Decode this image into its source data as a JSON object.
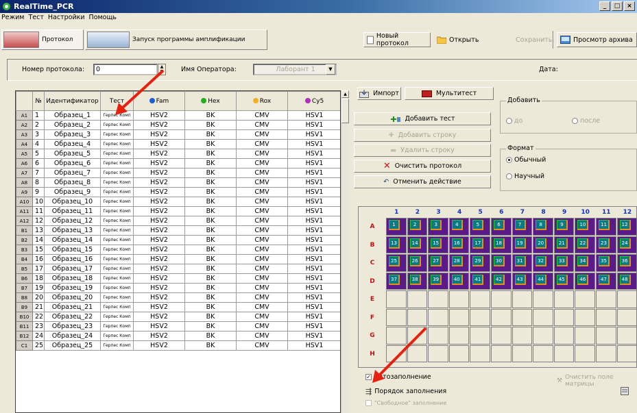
{
  "window": {
    "title": "RealTime_PCR"
  },
  "menu": [
    "Режим",
    "Тест",
    "Настройки",
    "Помощь"
  ],
  "tabs": [
    {
      "label": "Протокол"
    },
    {
      "label": "Запуск программы амплификации"
    }
  ],
  "toolbar": {
    "new_protocol": "Новый протокол",
    "open": "Открыть",
    "save": "Сохранить",
    "archive": "Просмотр архива"
  },
  "info": {
    "protocol_label": "Номер протокола:",
    "protocol_value": "0",
    "operator_label": "Имя Оператора:",
    "operator_value": "Лаборант 1",
    "date_label": "Дата:"
  },
  "table": {
    "headers": [
      "№",
      "Идентификатор",
      "Тест",
      "Fam",
      "Hex",
      "Rox",
      "Cy5"
    ],
    "channel_colors": {
      "Fam": "#1a5fd0",
      "Hex": "#22b022",
      "Rox": "#f0b020",
      "Cy5": "#b030c0"
    },
    "rows": [
      [
        "A1",
        "1",
        "Образец_1",
        "Герпес Комп",
        "HSV2",
        "BK",
        "CMV",
        "HSV1"
      ],
      [
        "A2",
        "2",
        "Образец_2",
        "Герпес Комп",
        "HSV2",
        "BK",
        "CMV",
        "HSV1"
      ],
      [
        "A3",
        "3",
        "Образец_3",
        "Герпес Комп",
        "HSV2",
        "BK",
        "CMV",
        "HSV1"
      ],
      [
        "A4",
        "4",
        "Образец_4",
        "Герпес Комп",
        "HSV2",
        "BK",
        "CMV",
        "HSV1"
      ],
      [
        "A5",
        "5",
        "Образец_5",
        "Герпес Комп",
        "HSV2",
        "BK",
        "CMV",
        "HSV1"
      ],
      [
        "A6",
        "6",
        "Образец_6",
        "Герпес Комп",
        "HSV2",
        "BK",
        "CMV",
        "HSV1"
      ],
      [
        "A7",
        "7",
        "Образец_7",
        "Герпес Комп",
        "HSV2",
        "BK",
        "CMV",
        "HSV1"
      ],
      [
        "A8",
        "8",
        "Образец_8",
        "Герпес Комп",
        "HSV2",
        "BK",
        "CMV",
        "HSV1"
      ],
      [
        "A9",
        "9",
        "Образец_9",
        "Герпес Комп",
        "HSV2",
        "BK",
        "CMV",
        "HSV1"
      ],
      [
        "A10",
        "10",
        "Образец_10",
        "Герпес Комп",
        "HSV2",
        "BK",
        "CMV",
        "HSV1"
      ],
      [
        "A11",
        "11",
        "Образец_11",
        "Герпес Комп",
        "HSV2",
        "BK",
        "CMV",
        "HSV1"
      ],
      [
        "A12",
        "12",
        "Образец_12",
        "Герпес Комп",
        "HSV2",
        "BK",
        "CMV",
        "HSV1"
      ],
      [
        "B1",
        "13",
        "Образец_13",
        "Герпес Комп",
        "HSV2",
        "BK",
        "CMV",
        "HSV1"
      ],
      [
        "B2",
        "14",
        "Образец_14",
        "Герпес Комп",
        "HSV2",
        "BK",
        "CMV",
        "HSV1"
      ],
      [
        "B3",
        "15",
        "Образец_15",
        "Герпес Комп",
        "HSV2",
        "BK",
        "CMV",
        "HSV1"
      ],
      [
        "B4",
        "16",
        "Образец_16",
        "Герпес Комп",
        "HSV2",
        "BK",
        "CMV",
        "HSV1"
      ],
      [
        "B5",
        "17",
        "Образец_17",
        "Герпес Комп",
        "HSV2",
        "BK",
        "CMV",
        "HSV1"
      ],
      [
        "B6",
        "18",
        "Образец_18",
        "Герпес Комп",
        "HSV2",
        "BK",
        "CMV",
        "HSV1"
      ],
      [
        "B7",
        "19",
        "Образец_19",
        "Герпес Комп",
        "HSV2",
        "BK",
        "CMV",
        "HSV1"
      ],
      [
        "B8",
        "20",
        "Образец_20",
        "Герпес Комп",
        "HSV2",
        "BK",
        "CMV",
        "HSV1"
      ],
      [
        "B9",
        "21",
        "Образец_21",
        "Герпес Комп",
        "HSV2",
        "BK",
        "CMV",
        "HSV1"
      ],
      [
        "B10",
        "22",
        "Образец_22",
        "Герпес Комп",
        "HSV2",
        "BK",
        "CMV",
        "HSV1"
      ],
      [
        "B11",
        "23",
        "Образец_23",
        "Герпес Комп",
        "HSV2",
        "BK",
        "CMV",
        "HSV1"
      ],
      [
        "B12",
        "24",
        "Образец_24",
        "Герпес Комп",
        "HSV2",
        "BK",
        "CMV",
        "HSV1"
      ],
      [
        "C1",
        "25",
        "Образец_25",
        "Герпес Комп",
        "HSV2",
        "BK",
        "CMV",
        "HSV1"
      ]
    ]
  },
  "actions": {
    "import": "Импорт",
    "multitest": "Мультитест",
    "add_test": "Добавить тест",
    "add_row": "Добавить строку",
    "delete_row": "Удалить строку",
    "clear_protocol": "Очистить протокол",
    "undo": "Отменить действие"
  },
  "add_group": {
    "title": "Добавить",
    "before": "до",
    "after": "после"
  },
  "format_group": {
    "title": "Формат",
    "normal": "Обычный",
    "scientific": "Научный",
    "selected": "normal"
  },
  "plate": {
    "columns": [
      "1",
      "2",
      "3",
      "4",
      "5",
      "6",
      "7",
      "8",
      "9",
      "10",
      "11",
      "12"
    ],
    "rows": [
      "A",
      "B",
      "C",
      "D",
      "E",
      "F",
      "G",
      "H"
    ],
    "filled_count": 48
  },
  "bottom": {
    "autofill": "Автозаполнение",
    "fill_order": "Порядок заполнения",
    "clear_matrix": "Очистить поле матрицы",
    "free_fill": "\"Свободное\" заполнение"
  }
}
